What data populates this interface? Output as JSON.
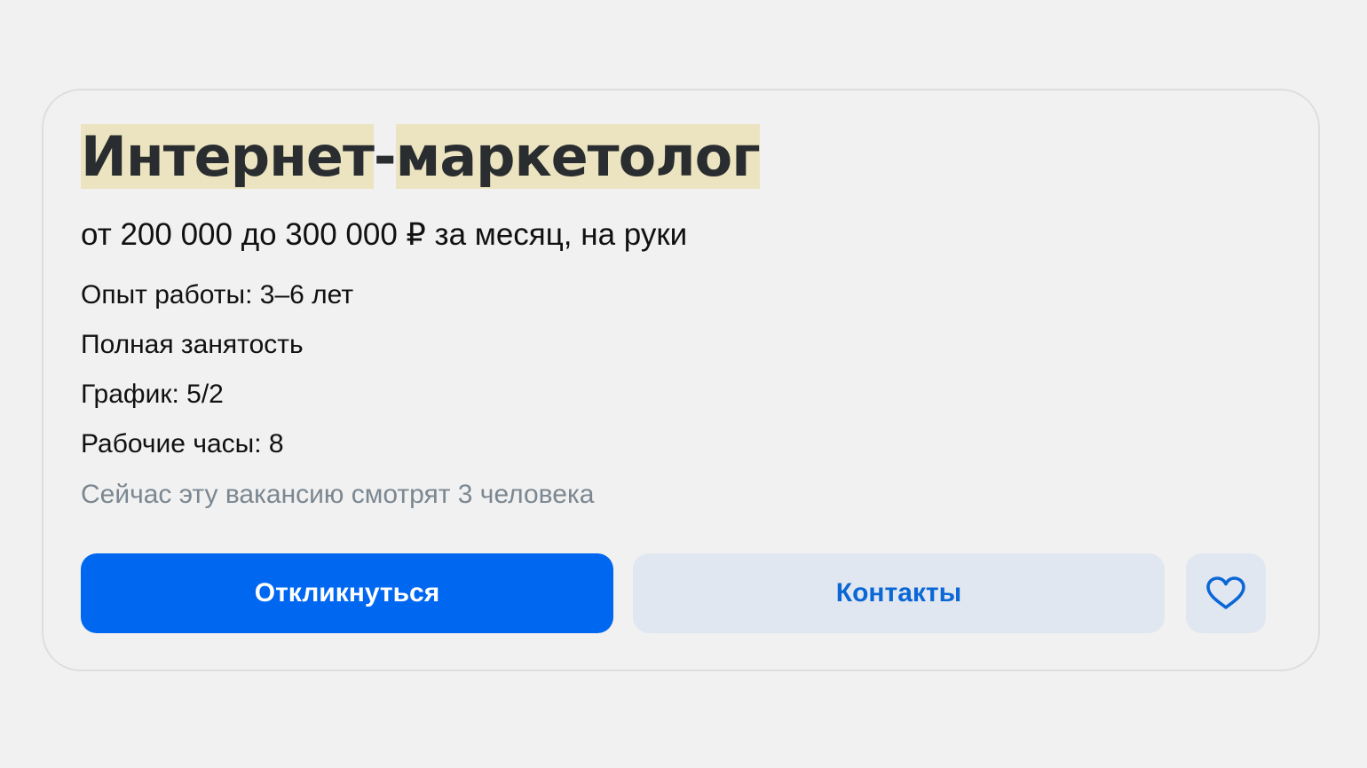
{
  "vacancy": {
    "title_part1": "Интернет",
    "title_sep": "-",
    "title_part2": "маркетолог",
    "salary": "от 200 000 до 300 000 ₽ за месяц, на руки",
    "details": [
      "Опыт работы: 3–6 лет",
      "Полная занятость",
      "График: 5/2",
      "Рабочие часы: 8"
    ],
    "viewers": "Сейчас эту вакансию смотрят 3 человека"
  },
  "actions": {
    "respond_label": "Откликнуться",
    "contacts_label": "Контакты",
    "favorite_icon": "heart-icon"
  },
  "colors": {
    "highlight": "#ece4c0",
    "primary": "#0068f0",
    "secondary_bg": "#e0e7f0",
    "secondary_text": "#0b67d6",
    "muted_text": "#7b8791"
  }
}
